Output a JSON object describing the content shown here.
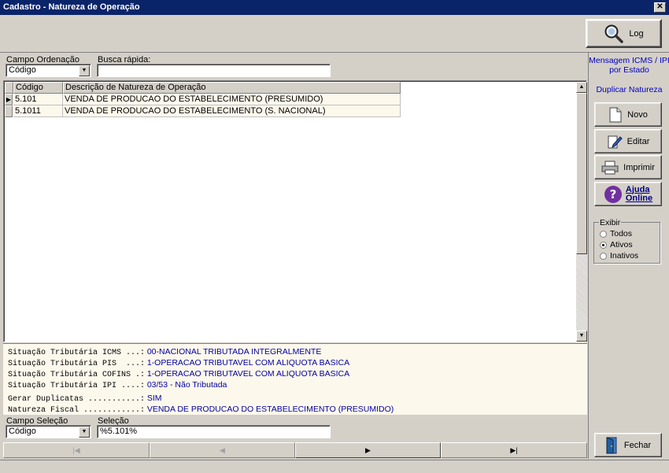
{
  "window": {
    "title": "Cadastro - Natureza de Operação",
    "close_glyph": "✕"
  },
  "toolbar": {
    "log_label": "Log",
    "log_icon": "magnifier-icon"
  },
  "filters": {
    "order_label": "Campo Ordenação",
    "order_value": "Código",
    "quick_search_label": "Busca rápida:",
    "quick_search_value": ""
  },
  "grid": {
    "columns": [
      "Código",
      "Descrição de Natureza de Operação"
    ],
    "rows": [
      {
        "code": "5.101",
        "desc": "VENDA DE PRODUCAO DO ESTABELECIMENTO (PRESUMIDO)"
      },
      {
        "code": "5.1011",
        "desc": "VENDA DE PRODUCAO DO ESTABELECIMENTO (S. NACIONAL)"
      }
    ],
    "current_row_marker": "▶"
  },
  "details": [
    {
      "key": "Situação Tributária ICMS ...:",
      "value": "00-NACIONAL TRIBUTADA INTEGRALMENTE"
    },
    {
      "key": "Situação Tributária PIS  ...:",
      "value": "1-OPERACAO TRIBUTAVEL COM ALIQUOTA BASICA"
    },
    {
      "key": "Situação Tributária COFINS .:",
      "value": "1-OPERACAO TRIBUTAVEL COM ALIQUOTA BASICA"
    },
    {
      "key": "Situação Tributária IPI ....:",
      "value": "03/53 - Não Tributada"
    },
    {
      "key": "Gerar Duplicatas ...........:",
      "value": "SIM"
    },
    {
      "key": "Natureza Fiscal ............:",
      "value": "VENDA DE PRODUCAO DO ESTABELECIMENTO (PRESUMIDO)"
    }
  ],
  "selection": {
    "field_label": "Campo Seleção",
    "field_value": "Código",
    "selection_label": "Seleção",
    "selection_value": "%5.101%"
  },
  "navigator": {
    "first": "|◀",
    "prev": "◀",
    "next": "▶",
    "last": "▶|"
  },
  "sidebar": {
    "link_icms": "Mensagem ICMS / IPI por Estado",
    "link_duplicate": "Duplicar Natureza",
    "new_label": "Novo",
    "edit_label": "Editar",
    "print_label": "Imprimir",
    "help_label_1": "Ajuda",
    "help_label_2": "Online",
    "close_label": "Fechar",
    "show_group_label": "Exibir",
    "show_options": [
      "Todos",
      "Ativos",
      "Inativos"
    ],
    "show_selected": "Ativos"
  },
  "colors": {
    "title_bar": "#0a246a",
    "link": "#0000c0",
    "detail_value": "#0000a0",
    "grid_row_bg": "#fdf8ec"
  }
}
